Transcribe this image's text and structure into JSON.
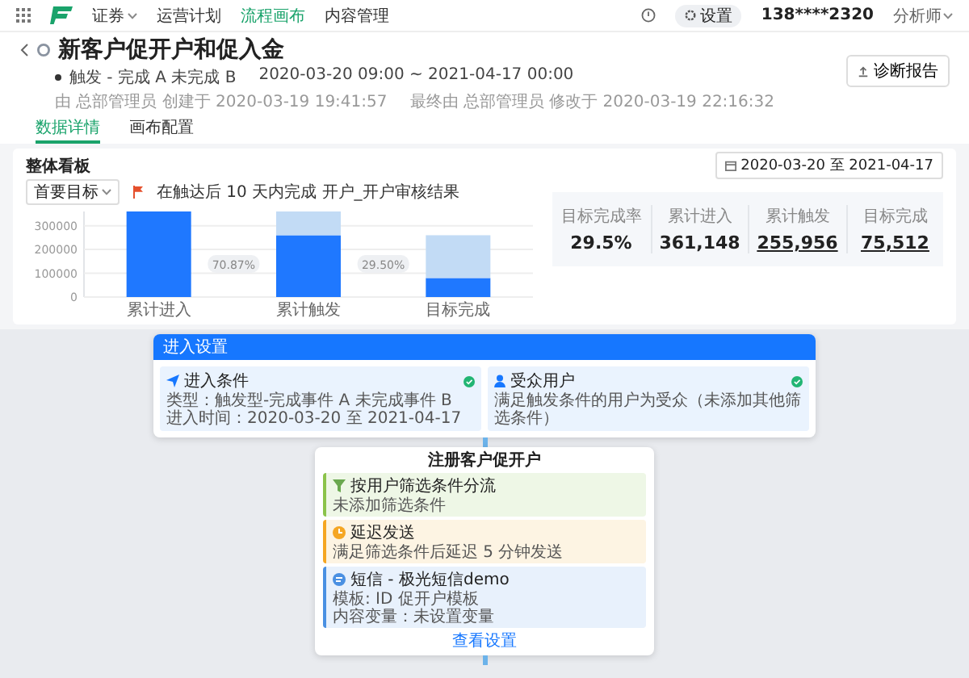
{
  "nav": {
    "items": [
      {
        "label": "证券",
        "kind": "dropdown",
        "selected": false
      },
      {
        "label": "运营计划",
        "kind": "link",
        "selected": false
      },
      {
        "label": "流程画布",
        "kind": "link",
        "selected": true
      },
      {
        "label": "内容管理",
        "kind": "link",
        "selected": false
      }
    ],
    "settings": "设置",
    "phone": "138****2320",
    "role": "分析师"
  },
  "header": {
    "title": "新客户促开户和促入金",
    "trigger": "触发 - 完成 A 未完成 B",
    "period": "2020-03-20 09:00 ~ 2021-04-17 00:00",
    "created": "由 总部管理员 创建于 2020-03-19 19:41:57",
    "modified": "最终由 总部管理员 修改于 2020-03-19 22:16:32",
    "report_button": "诊断报告"
  },
  "tabs": [
    {
      "label": "数据详情",
      "selected": true
    },
    {
      "label": "画布配置",
      "selected": false
    }
  ],
  "dashboard": {
    "title": "整体看板",
    "date_range": "2020-03-20 至 2021-04-17",
    "goal_select": "首要目标",
    "goal_text": "在触达后 10 天内完成 开户_开户审核结果",
    "chart_data": {
      "type": "bar",
      "categories": [
        "累计进入",
        "累计触发",
        "目标完成"
      ],
      "stacked": true,
      "grid": true,
      "ylim": [
        0,
        360000
      ],
      "yticks": [
        0,
        100000,
        200000,
        300000
      ],
      "series": [
        {
          "color": "#1f78ff",
          "values": [
            360000,
            260000,
            80000
          ]
        },
        {
          "color": "#c2dbf5",
          "values": [
            0,
            100000,
            180000
          ]
        }
      ],
      "annotations": [
        {
          "text": "70.87%"
        },
        {
          "text": "29.50%"
        }
      ]
    },
    "stats": [
      {
        "label": "目标完成率",
        "value": "29.5%",
        "kind": "plain"
      },
      {
        "label": "累计进入",
        "value": "361,148",
        "kind": "plain"
      },
      {
        "label": "累计触发",
        "value": "255,956",
        "kind": "link"
      },
      {
        "label": "目标完成",
        "value": "75,512",
        "kind": "link"
      }
    ]
  },
  "flow": {
    "entry_node": {
      "title": "进入设置",
      "cards": [
        {
          "title": "进入条件",
          "lines": [
            "类型：触发型-完成事件 A 未完成事件 B",
            "进入时间：2020-03-20 至 2021-04-17"
          ]
        },
        {
          "title": "受众用户",
          "lines": [
            "满足触发条件的用户为受众（未添加其他筛选条件）"
          ]
        }
      ]
    },
    "step_node": {
      "title": "注册客户促开户",
      "items": [
        {
          "kind": "filter",
          "color": "#8bc34a",
          "title": "按用户筛选条件分流",
          "lines": [
            "未添加筛选条件"
          ]
        },
        {
          "kind": "delay",
          "color": "#f5a623",
          "title": "延迟发送",
          "lines": [
            "满足筛选条件后延迟 5 分钟发送"
          ]
        },
        {
          "kind": "message",
          "color": "#4a90e2",
          "title": "短信 - 极光短信demo",
          "lines": [
            "模板: ID 促开户模板",
            "内容变量：未设置变量"
          ]
        }
      ],
      "link": "查看设置"
    }
  }
}
